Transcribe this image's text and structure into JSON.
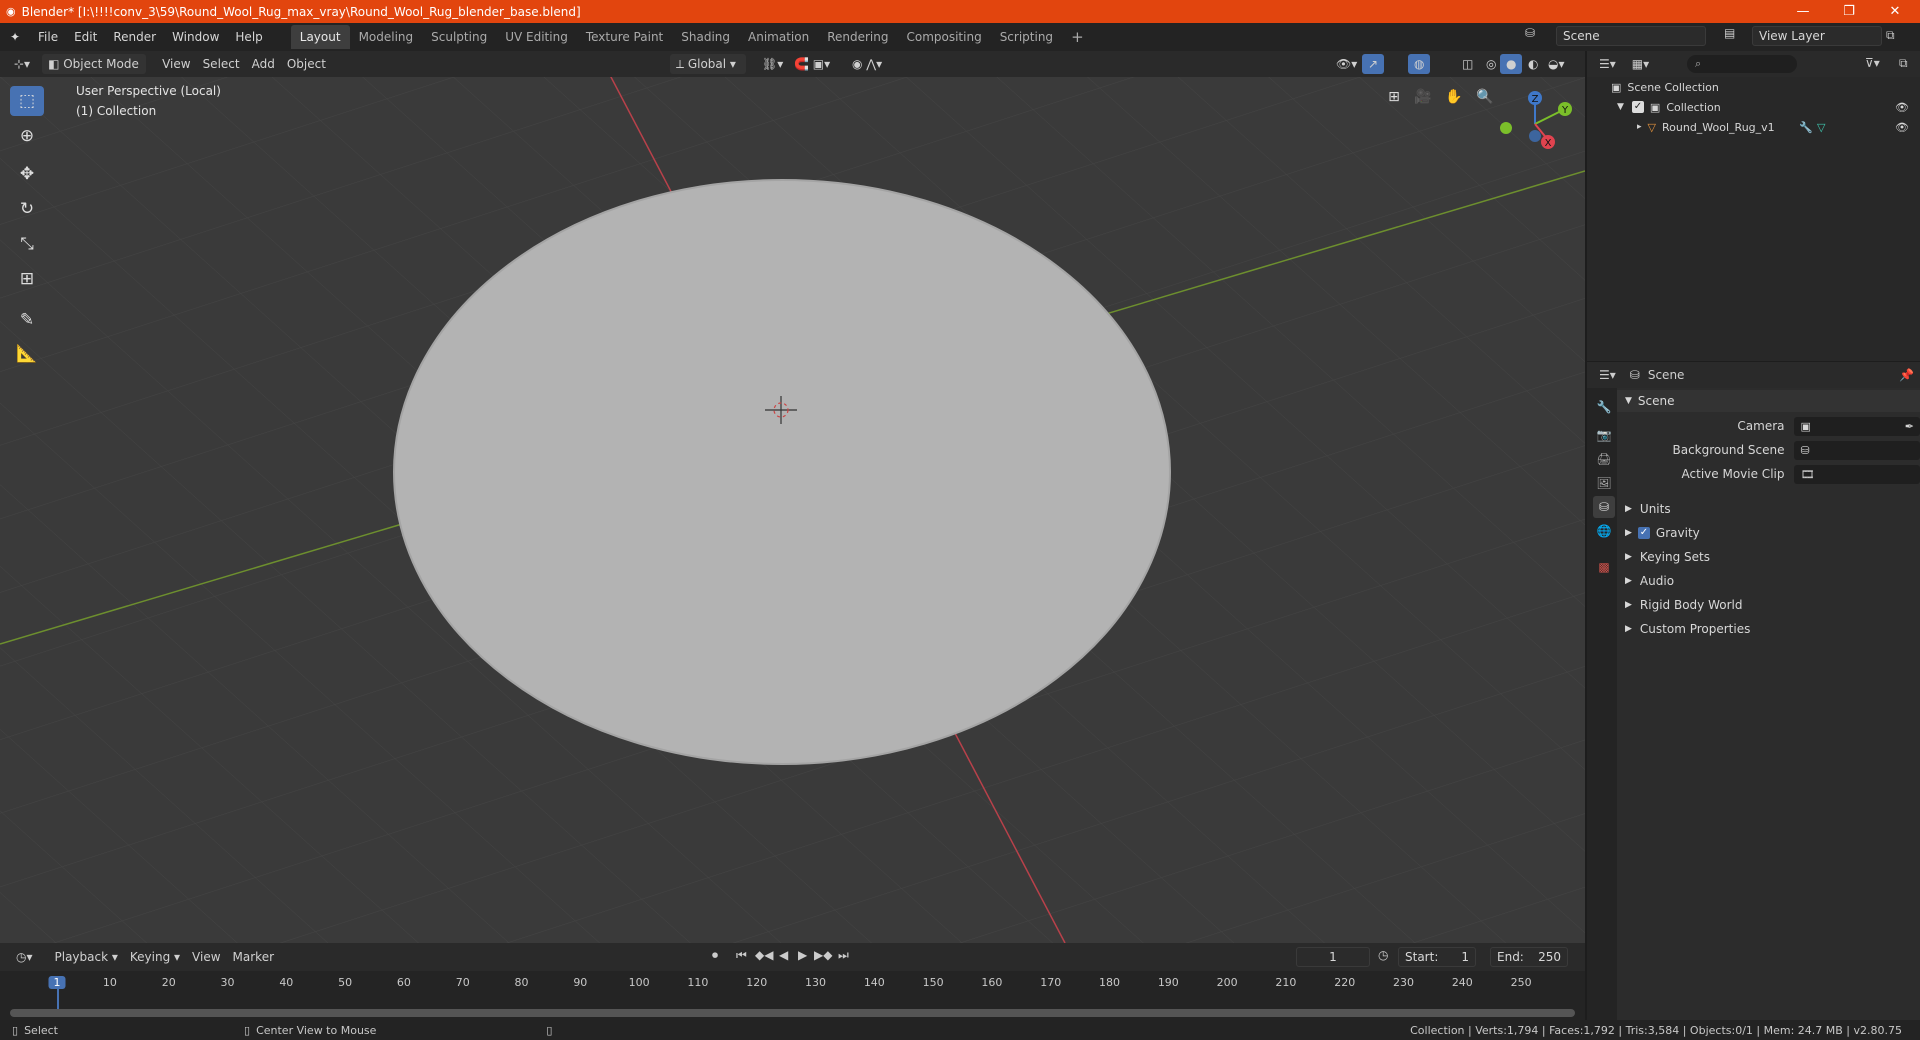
{
  "titlebar": {
    "title": "Blender* [I:\\!!!!conv_3\\59\\Round_Wool_Rug_max_vray\\Round_Wool_Rug_blender_base.blend]",
    "minimize": "—",
    "maximize": "❐",
    "close": "✕"
  },
  "menus": [
    "File",
    "Edit",
    "Render",
    "Window",
    "Help"
  ],
  "workspaces": [
    "Layout",
    "Modeling",
    "Sculpting",
    "UV Editing",
    "Texture Paint",
    "Shading",
    "Animation",
    "Rendering",
    "Compositing",
    "Scripting"
  ],
  "active_workspace": "Layout",
  "scene_field": "Scene",
  "view_layer_field": "View Layer",
  "viewport_header": {
    "mode": "Object Mode",
    "menus": [
      "View",
      "Select",
      "Add",
      "Object"
    ],
    "transform_orientation": "Global"
  },
  "viewport": {
    "perspective_label": "User Perspective (Local)",
    "collection_label": "(1) Collection",
    "axis_x": "X",
    "axis_y": "Y",
    "axis_z": "Z",
    "colors": {
      "background": "#3a3a3a",
      "rug": "#b3b3b3",
      "x_axis": "#b8414a",
      "y_axis": "#6d8f2e"
    }
  },
  "outliner": {
    "scene_collection": "Scene Collection",
    "collection": "Collection",
    "object": "Round_Wool_Rug_v1"
  },
  "properties": {
    "header": "Scene",
    "section": "Scene",
    "camera_label": "Camera",
    "background_scene_label": "Background Scene",
    "active_movie_clip_label": "Active Movie Clip",
    "panels": [
      "Units",
      "Gravity",
      "Keying Sets",
      "Audio",
      "Rigid Body World",
      "Custom Properties"
    ]
  },
  "timeline": {
    "menus": [
      "Playback",
      "Keying",
      "View",
      "Marker"
    ],
    "current_frame": "1",
    "start_label": "Start:",
    "start_value": "1",
    "end_label": "End:",
    "end_value": "250",
    "ticks": [
      "1",
      "10",
      "20",
      "30",
      "40",
      "50",
      "60",
      "70",
      "80",
      "90",
      "100",
      "110",
      "120",
      "130",
      "140",
      "150",
      "160",
      "170",
      "180",
      "190",
      "200",
      "210",
      "220",
      "230",
      "240",
      "250"
    ]
  },
  "statusbar": {
    "select": "Select",
    "center_view": "Center View to Mouse",
    "stats": "Collection | Verts:1,794 | Faces:1,792 | Tris:3,584 | Objects:0/1 | Mem: 24.7 MB | v2.80.75"
  }
}
